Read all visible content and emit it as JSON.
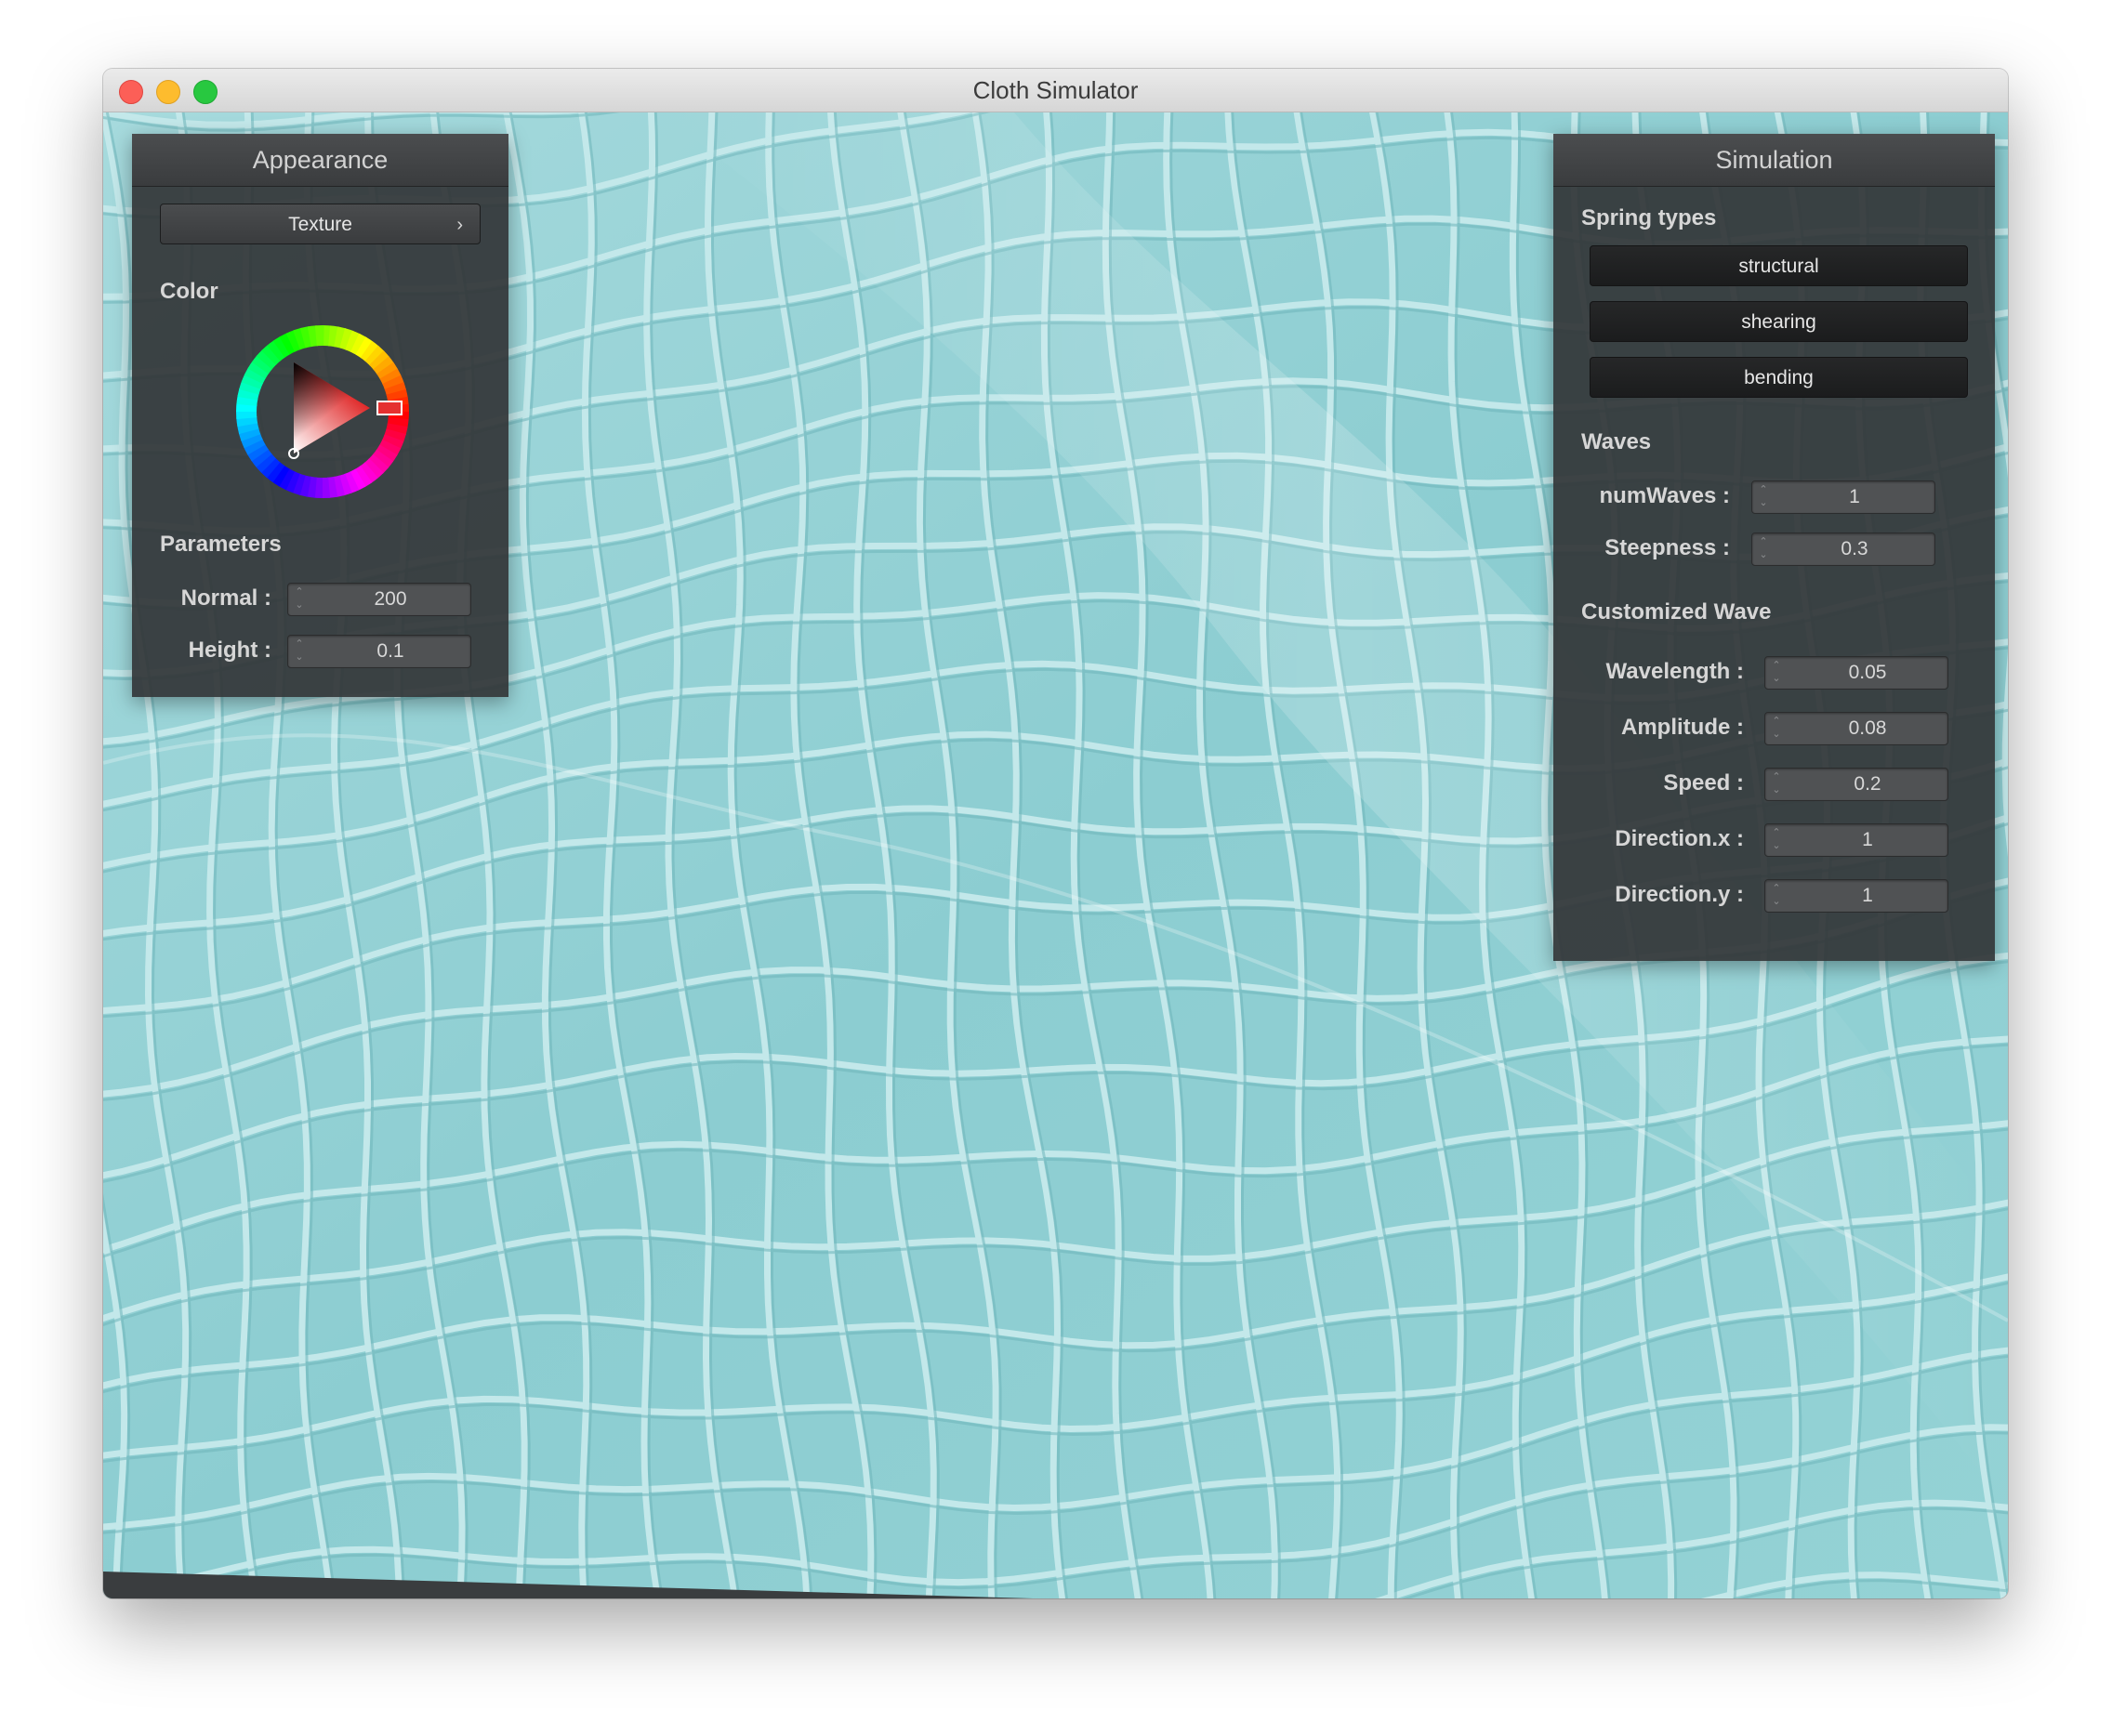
{
  "window": {
    "title": "Cloth Simulator"
  },
  "appearance": {
    "title": "Appearance",
    "texture_button": "Texture",
    "texture_chevron": "›",
    "color_label": "Color",
    "selected_color": "#e03030",
    "parameters_label": "Parameters",
    "params": [
      {
        "label": "Normal :",
        "value": "200"
      },
      {
        "label": "Height :",
        "value": "0.1"
      }
    ]
  },
  "simulation": {
    "title": "Simulation",
    "spring_types_label": "Spring types",
    "spring_types": [
      "structural",
      "shearing",
      "bending"
    ],
    "waves_label": "Waves",
    "waves": [
      {
        "label": "numWaves :",
        "value": "1"
      },
      {
        "label": "Steepness :",
        "value": "0.3"
      }
    ],
    "customized_label": "Customized Wave",
    "customized": [
      {
        "label": "Wavelength :",
        "value": "0.05"
      },
      {
        "label": "Amplitude :",
        "value": "0.08"
      },
      {
        "label": "Speed :",
        "value": "0.2"
      },
      {
        "label": "Direction.x :",
        "value": "1"
      },
      {
        "label": "Direction.y :",
        "value": "1"
      }
    ]
  },
  "colors": {
    "cloth": "#8fcfd3",
    "cloth_ridge": "#bfe6e8",
    "panel_bg": "#333638"
  },
  "icons": {
    "spinner": "spinner-arrows-icon",
    "chevron": "chevron-right-icon"
  }
}
